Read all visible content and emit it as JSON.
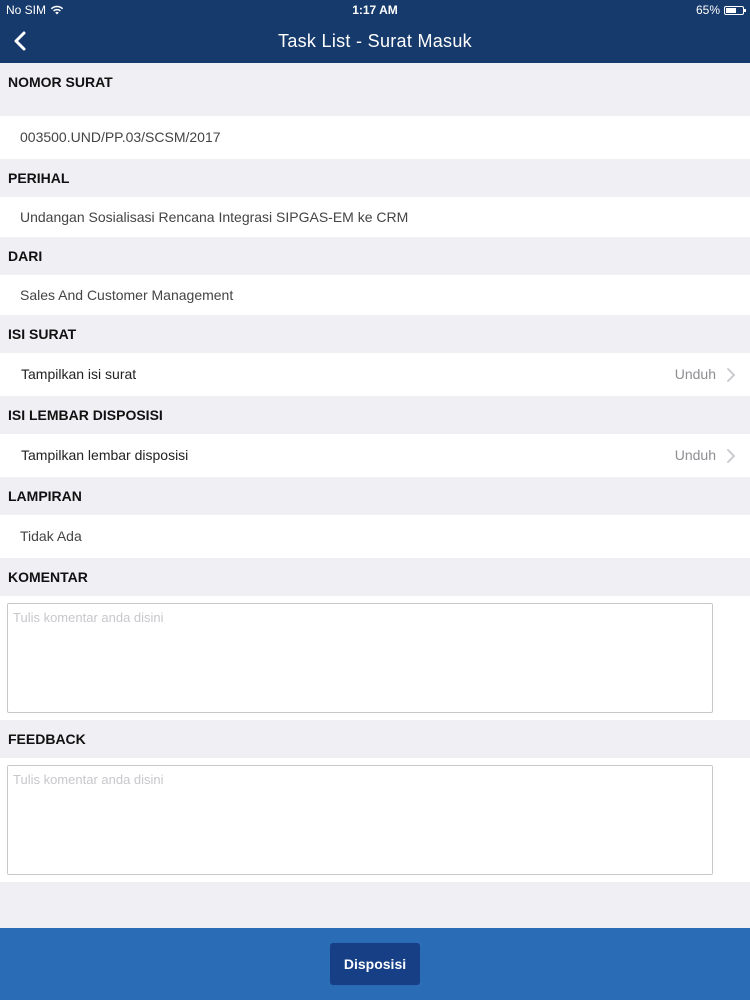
{
  "status_bar": {
    "carrier": "No SIM",
    "time": "1:17 AM",
    "battery": "65%",
    "battery_level": 0.65
  },
  "nav": {
    "title": "Task List - Surat Masuk",
    "back_icon": "chevron-left-icon"
  },
  "sections": {
    "nomor_surat": {
      "label": "NOMOR SURAT",
      "value": "003500.UND/PP.03/SCSM/2017"
    },
    "perihal": {
      "label": "PERIHAL",
      "value": "Undangan Sosialisasi Rencana Integrasi SIPGAS-EM ke CRM"
    },
    "dari": {
      "label": "DARI",
      "value": "Sales And Customer Management"
    },
    "isi_surat": {
      "label": "ISI SURAT",
      "link": "Tampilkan isi surat",
      "action": "Unduh"
    },
    "isi_lembar": {
      "label": "ISI LEMBAR DISPOSISI",
      "link": "Tampilkan lembar disposisi",
      "action": "Unduh"
    },
    "lampiran": {
      "label": "LAMPIRAN",
      "value": "Tidak Ada"
    },
    "komentar": {
      "label": "KOMENTAR",
      "placeholder": "Tulis komentar anda disini",
      "value": ""
    },
    "feedback": {
      "label": "FEEDBACK",
      "placeholder": "Tulis komentar anda disini",
      "value": ""
    }
  },
  "footer": {
    "button_label": "Disposisi"
  },
  "colors": {
    "nav_bg": "#163a6b",
    "footer_bg": "#2a6db6",
    "button_bg": "#163f86",
    "page_bg": "#efeff4"
  }
}
